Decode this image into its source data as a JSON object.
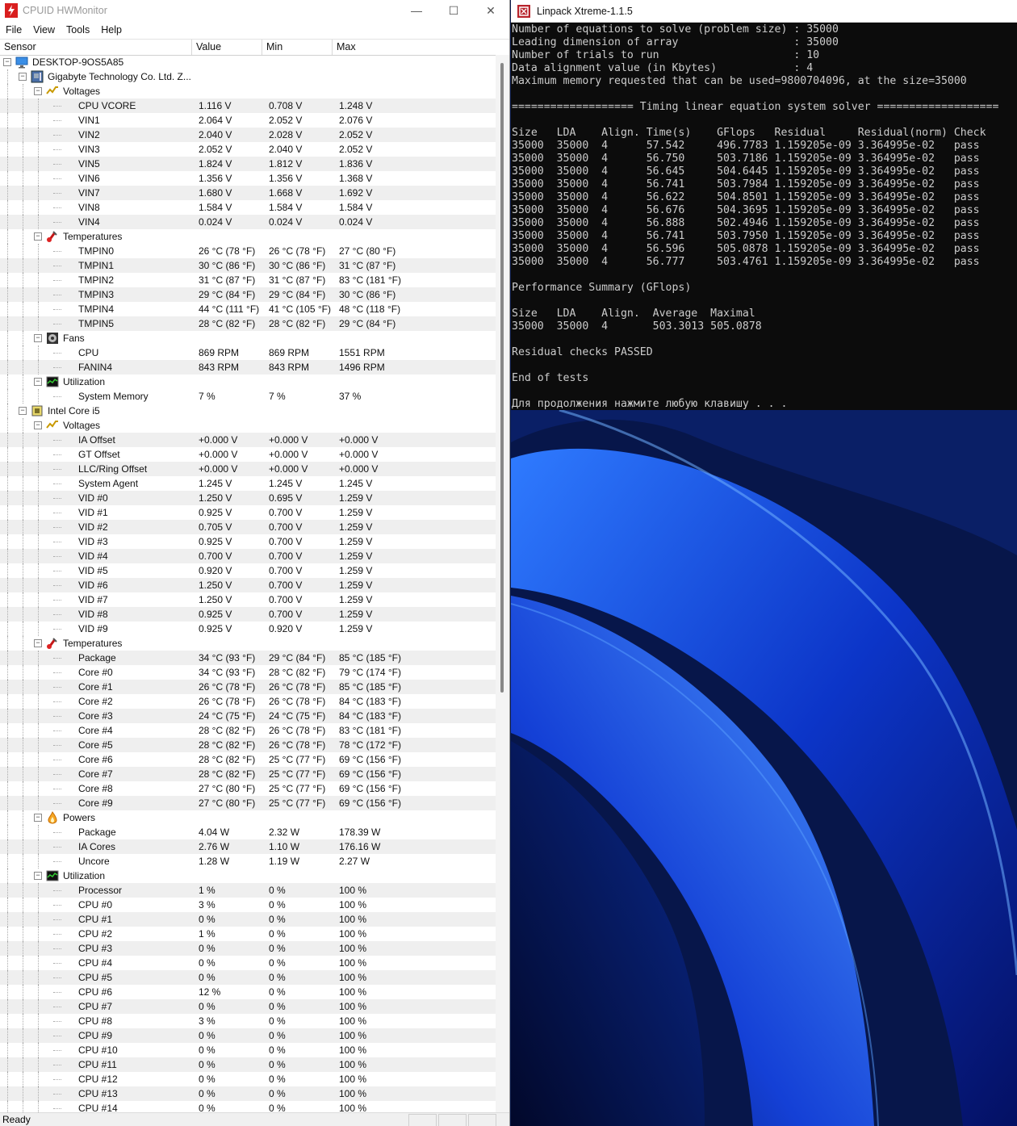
{
  "hwmonitor": {
    "title": "CPUID HWMonitor",
    "menu": [
      "File",
      "View",
      "Tools",
      "Help"
    ],
    "columns": [
      "Sensor",
      "Value",
      "Min",
      "Max"
    ],
    "status": "Ready",
    "rows": [
      {
        "lvl": 0,
        "type": "computer",
        "label": "DESKTOP-9OS5A85"
      },
      {
        "lvl": 1,
        "type": "board",
        "label": "Gigabyte Technology Co. Ltd. Z..."
      },
      {
        "lvl": 2,
        "type": "volt",
        "label": "Voltages"
      },
      {
        "lvl": 3,
        "label": "CPU VCORE",
        "v": "1.116 V",
        "mn": "0.708 V",
        "mx": "1.248 V"
      },
      {
        "lvl": 3,
        "label": "VIN1",
        "v": "2.064 V",
        "mn": "2.052 V",
        "mx": "2.076 V"
      },
      {
        "lvl": 3,
        "label": "VIN2",
        "v": "2.040 V",
        "mn": "2.028 V",
        "mx": "2.052 V"
      },
      {
        "lvl": 3,
        "label": "VIN3",
        "v": "2.052 V",
        "mn": "2.040 V",
        "mx": "2.052 V"
      },
      {
        "lvl": 3,
        "label": "VIN5",
        "v": "1.824 V",
        "mn": "1.812 V",
        "mx": "1.836 V"
      },
      {
        "lvl": 3,
        "label": "VIN6",
        "v": "1.356 V",
        "mn": "1.356 V",
        "mx": "1.368 V"
      },
      {
        "lvl": 3,
        "label": "VIN7",
        "v": "1.680 V",
        "mn": "1.668 V",
        "mx": "1.692 V"
      },
      {
        "lvl": 3,
        "label": "VIN8",
        "v": "1.584 V",
        "mn": "1.584 V",
        "mx": "1.584 V"
      },
      {
        "lvl": 3,
        "label": "VIN4",
        "v": "0.024 V",
        "mn": "0.024 V",
        "mx": "0.024 V"
      },
      {
        "lvl": 2,
        "type": "temp",
        "label": "Temperatures"
      },
      {
        "lvl": 3,
        "label": "TMPIN0",
        "v": "26 °C  (78 °F)",
        "mn": "26 °C  (78 °F)",
        "mx": "27 °C  (80 °F)"
      },
      {
        "lvl": 3,
        "label": "TMPIN1",
        "v": "30 °C  (86 °F)",
        "mn": "30 °C  (86 °F)",
        "mx": "31 °C  (87 °F)"
      },
      {
        "lvl": 3,
        "label": "TMPIN2",
        "v": "31 °C  (87 °F)",
        "mn": "31 °C  (87 °F)",
        "mx": "83 °C  (181 °F)"
      },
      {
        "lvl": 3,
        "label": "TMPIN3",
        "v": "29 °C  (84 °F)",
        "mn": "29 °C  (84 °F)",
        "mx": "30 °C  (86 °F)"
      },
      {
        "lvl": 3,
        "label": "TMPIN4",
        "v": "44 °C  (111 °F)",
        "mn": "41 °C  (105 °F)",
        "mx": "48 °C  (118 °F)"
      },
      {
        "lvl": 3,
        "label": "TMPIN5",
        "v": "28 °C  (82 °F)",
        "mn": "28 °C  (82 °F)",
        "mx": "29 °C  (84 °F)"
      },
      {
        "lvl": 2,
        "type": "fan",
        "label": "Fans"
      },
      {
        "lvl": 3,
        "label": "CPU",
        "v": "869 RPM",
        "mn": "869 RPM",
        "mx": "1551 RPM"
      },
      {
        "lvl": 3,
        "label": "FANIN4",
        "v": "843 RPM",
        "mn": "843 RPM",
        "mx": "1496 RPM"
      },
      {
        "lvl": 2,
        "type": "util",
        "label": "Utilization"
      },
      {
        "lvl": 3,
        "label": "System Memory",
        "v": "7 %",
        "mn": "7 %",
        "mx": "37 %"
      },
      {
        "lvl": 1,
        "type": "cpu",
        "label": "Intel Core i5"
      },
      {
        "lvl": 2,
        "type": "volt",
        "label": "Voltages"
      },
      {
        "lvl": 3,
        "label": "IA Offset",
        "v": "+0.000 V",
        "mn": "+0.000 V",
        "mx": "+0.000 V"
      },
      {
        "lvl": 3,
        "label": "GT Offset",
        "v": "+0.000 V",
        "mn": "+0.000 V",
        "mx": "+0.000 V"
      },
      {
        "lvl": 3,
        "label": "LLC/Ring Offset",
        "v": "+0.000 V",
        "mn": "+0.000 V",
        "mx": "+0.000 V"
      },
      {
        "lvl": 3,
        "label": "System Agent",
        "v": "1.245 V",
        "mn": "1.245 V",
        "mx": "1.245 V"
      },
      {
        "lvl": 3,
        "label": "VID #0",
        "v": "1.250 V",
        "mn": "0.695 V",
        "mx": "1.259 V"
      },
      {
        "lvl": 3,
        "label": "VID #1",
        "v": "0.925 V",
        "mn": "0.700 V",
        "mx": "1.259 V"
      },
      {
        "lvl": 3,
        "label": "VID #2",
        "v": "0.705 V",
        "mn": "0.700 V",
        "mx": "1.259 V"
      },
      {
        "lvl": 3,
        "label": "VID #3",
        "v": "0.925 V",
        "mn": "0.700 V",
        "mx": "1.259 V"
      },
      {
        "lvl": 3,
        "label": "VID #4",
        "v": "0.700 V",
        "mn": "0.700 V",
        "mx": "1.259 V"
      },
      {
        "lvl": 3,
        "label": "VID #5",
        "v": "0.920 V",
        "mn": "0.700 V",
        "mx": "1.259 V"
      },
      {
        "lvl": 3,
        "label": "VID #6",
        "v": "1.250 V",
        "mn": "0.700 V",
        "mx": "1.259 V"
      },
      {
        "lvl": 3,
        "label": "VID #7",
        "v": "1.250 V",
        "mn": "0.700 V",
        "mx": "1.259 V"
      },
      {
        "lvl": 3,
        "label": "VID #8",
        "v": "0.925 V",
        "mn": "0.700 V",
        "mx": "1.259 V"
      },
      {
        "lvl": 3,
        "label": "VID #9",
        "v": "0.925 V",
        "mn": "0.920 V",
        "mx": "1.259 V"
      },
      {
        "lvl": 2,
        "type": "temp",
        "label": "Temperatures"
      },
      {
        "lvl": 3,
        "label": "Package",
        "v": "34 °C  (93 °F)",
        "mn": "29 °C  (84 °F)",
        "mx": "85 °C  (185 °F)"
      },
      {
        "lvl": 3,
        "label": "Core #0",
        "v": "34 °C  (93 °F)",
        "mn": "28 °C  (82 °F)",
        "mx": "79 °C  (174 °F)"
      },
      {
        "lvl": 3,
        "label": "Core #1",
        "v": "26 °C  (78 °F)",
        "mn": "26 °C  (78 °F)",
        "mx": "85 °C  (185 °F)"
      },
      {
        "lvl": 3,
        "label": "Core #2",
        "v": "26 °C  (78 °F)",
        "mn": "26 °C  (78 °F)",
        "mx": "84 °C  (183 °F)"
      },
      {
        "lvl": 3,
        "label": "Core #3",
        "v": "24 °C  (75 °F)",
        "mn": "24 °C  (75 °F)",
        "mx": "84 °C  (183 °F)"
      },
      {
        "lvl": 3,
        "label": "Core #4",
        "v": "28 °C  (82 °F)",
        "mn": "26 °C  (78 °F)",
        "mx": "83 °C  (181 °F)"
      },
      {
        "lvl": 3,
        "label": "Core #5",
        "v": "28 °C  (82 °F)",
        "mn": "26 °C  (78 °F)",
        "mx": "78 °C  (172 °F)"
      },
      {
        "lvl": 3,
        "label": "Core #6",
        "v": "28 °C  (82 °F)",
        "mn": "25 °C  (77 °F)",
        "mx": "69 °C  (156 °F)"
      },
      {
        "lvl": 3,
        "label": "Core #7",
        "v": "28 °C  (82 °F)",
        "mn": "25 °C  (77 °F)",
        "mx": "69 °C  (156 °F)"
      },
      {
        "lvl": 3,
        "label": "Core #8",
        "v": "27 °C  (80 °F)",
        "mn": "25 °C  (77 °F)",
        "mx": "69 °C  (156 °F)"
      },
      {
        "lvl": 3,
        "label": "Core #9",
        "v": "27 °C  (80 °F)",
        "mn": "25 °C  (77 °F)",
        "mx": "69 °C  (156 °F)"
      },
      {
        "lvl": 2,
        "type": "power",
        "label": "Powers"
      },
      {
        "lvl": 3,
        "label": "Package",
        "v": "4.04 W",
        "mn": "2.32 W",
        "mx": "178.39 W"
      },
      {
        "lvl": 3,
        "label": "IA Cores",
        "v": "2.76 W",
        "mn": "1.10 W",
        "mx": "176.16 W"
      },
      {
        "lvl": 3,
        "label": "Uncore",
        "v": "1.28 W",
        "mn": "1.19 W",
        "mx": "2.27 W"
      },
      {
        "lvl": 2,
        "type": "util",
        "label": "Utilization"
      },
      {
        "lvl": 3,
        "label": "Processor",
        "v": "1 %",
        "mn": "0 %",
        "mx": "100 %"
      },
      {
        "lvl": 3,
        "label": "CPU #0",
        "v": "3 %",
        "mn": "0 %",
        "mx": "100 %"
      },
      {
        "lvl": 3,
        "label": "CPU #1",
        "v": "0 %",
        "mn": "0 %",
        "mx": "100 %"
      },
      {
        "lvl": 3,
        "label": "CPU #2",
        "v": "1 %",
        "mn": "0 %",
        "mx": "100 %"
      },
      {
        "lvl": 3,
        "label": "CPU #3",
        "v": "0 %",
        "mn": "0 %",
        "mx": "100 %"
      },
      {
        "lvl": 3,
        "label": "CPU #4",
        "v": "0 %",
        "mn": "0 %",
        "mx": "100 %"
      },
      {
        "lvl": 3,
        "label": "CPU #5",
        "v": "0 %",
        "mn": "0 %",
        "mx": "100 %"
      },
      {
        "lvl": 3,
        "label": "CPU #6",
        "v": "12 %",
        "mn": "0 %",
        "mx": "100 %"
      },
      {
        "lvl": 3,
        "label": "CPU #7",
        "v": "0 %",
        "mn": "0 %",
        "mx": "100 %"
      },
      {
        "lvl": 3,
        "label": "CPU #8",
        "v": "3 %",
        "mn": "0 %",
        "mx": "100 %"
      },
      {
        "lvl": 3,
        "label": "CPU #9",
        "v": "0 %",
        "mn": "0 %",
        "mx": "100 %"
      },
      {
        "lvl": 3,
        "label": "CPU #10",
        "v": "0 %",
        "mn": "0 %",
        "mx": "100 %"
      },
      {
        "lvl": 3,
        "label": "CPU #11",
        "v": "0 %",
        "mn": "0 %",
        "mx": "100 %"
      },
      {
        "lvl": 3,
        "label": "CPU #12",
        "v": "0 %",
        "mn": "0 %",
        "mx": "100 %"
      },
      {
        "lvl": 3,
        "label": "CPU #13",
        "v": "0 %",
        "mn": "0 %",
        "mx": "100 %"
      },
      {
        "lvl": 3,
        "label": "CPU #14",
        "v": "0 %",
        "mn": "0 %",
        "mx": "100 %"
      }
    ]
  },
  "linpack": {
    "title": "Linpack Xtreme-1.1.5",
    "lines": [
      "Number of equations to solve (problem size) : 35000",
      "Leading dimension of array                  : 35000",
      "Number of trials to run                     : 10",
      "Data alignment value (in Kbytes)            : 4",
      "Maximum memory requested that can be used=9800704096, at the size=35000",
      "",
      "=================== Timing linear equation system solver ===================",
      "",
      "Size   LDA    Align. Time(s)    GFlops   Residual     Residual(norm) Check",
      "35000  35000  4      57.542     496.7783 1.159205e-09 3.364995e-02   pass",
      "35000  35000  4      56.750     503.7186 1.159205e-09 3.364995e-02   pass",
      "35000  35000  4      56.645     504.6445 1.159205e-09 3.364995e-02   pass",
      "35000  35000  4      56.741     503.7984 1.159205e-09 3.364995e-02   pass",
      "35000  35000  4      56.622     504.8501 1.159205e-09 3.364995e-02   pass",
      "35000  35000  4      56.676     504.3695 1.159205e-09 3.364995e-02   pass",
      "35000  35000  4      56.888     502.4946 1.159205e-09 3.364995e-02   pass",
      "35000  35000  4      56.741     503.7950 1.159205e-09 3.364995e-02   pass",
      "35000  35000  4      56.596     505.0878 1.159205e-09 3.364995e-02   pass",
      "35000  35000  4      56.777     503.4761 1.159205e-09 3.364995e-02   pass",
      "",
      "Performance Summary (GFlops)",
      "",
      "Size   LDA    Align.  Average  Maximal",
      "35000  35000  4       503.3013 505.0878",
      "",
      "Residual checks PASSED",
      "",
      "End of tests",
      "",
      "Для продолжения нажмите любую клавишу . . ."
    ]
  },
  "window_buttons": {
    "minimize": "—",
    "maximize": "☐",
    "close": "✕"
  },
  "colors": {
    "console_bg": "#0c0c0c",
    "console_fg": "#cccccc",
    "alt_row": "#efefef",
    "wallpaper_accent": "#1f5cff"
  }
}
